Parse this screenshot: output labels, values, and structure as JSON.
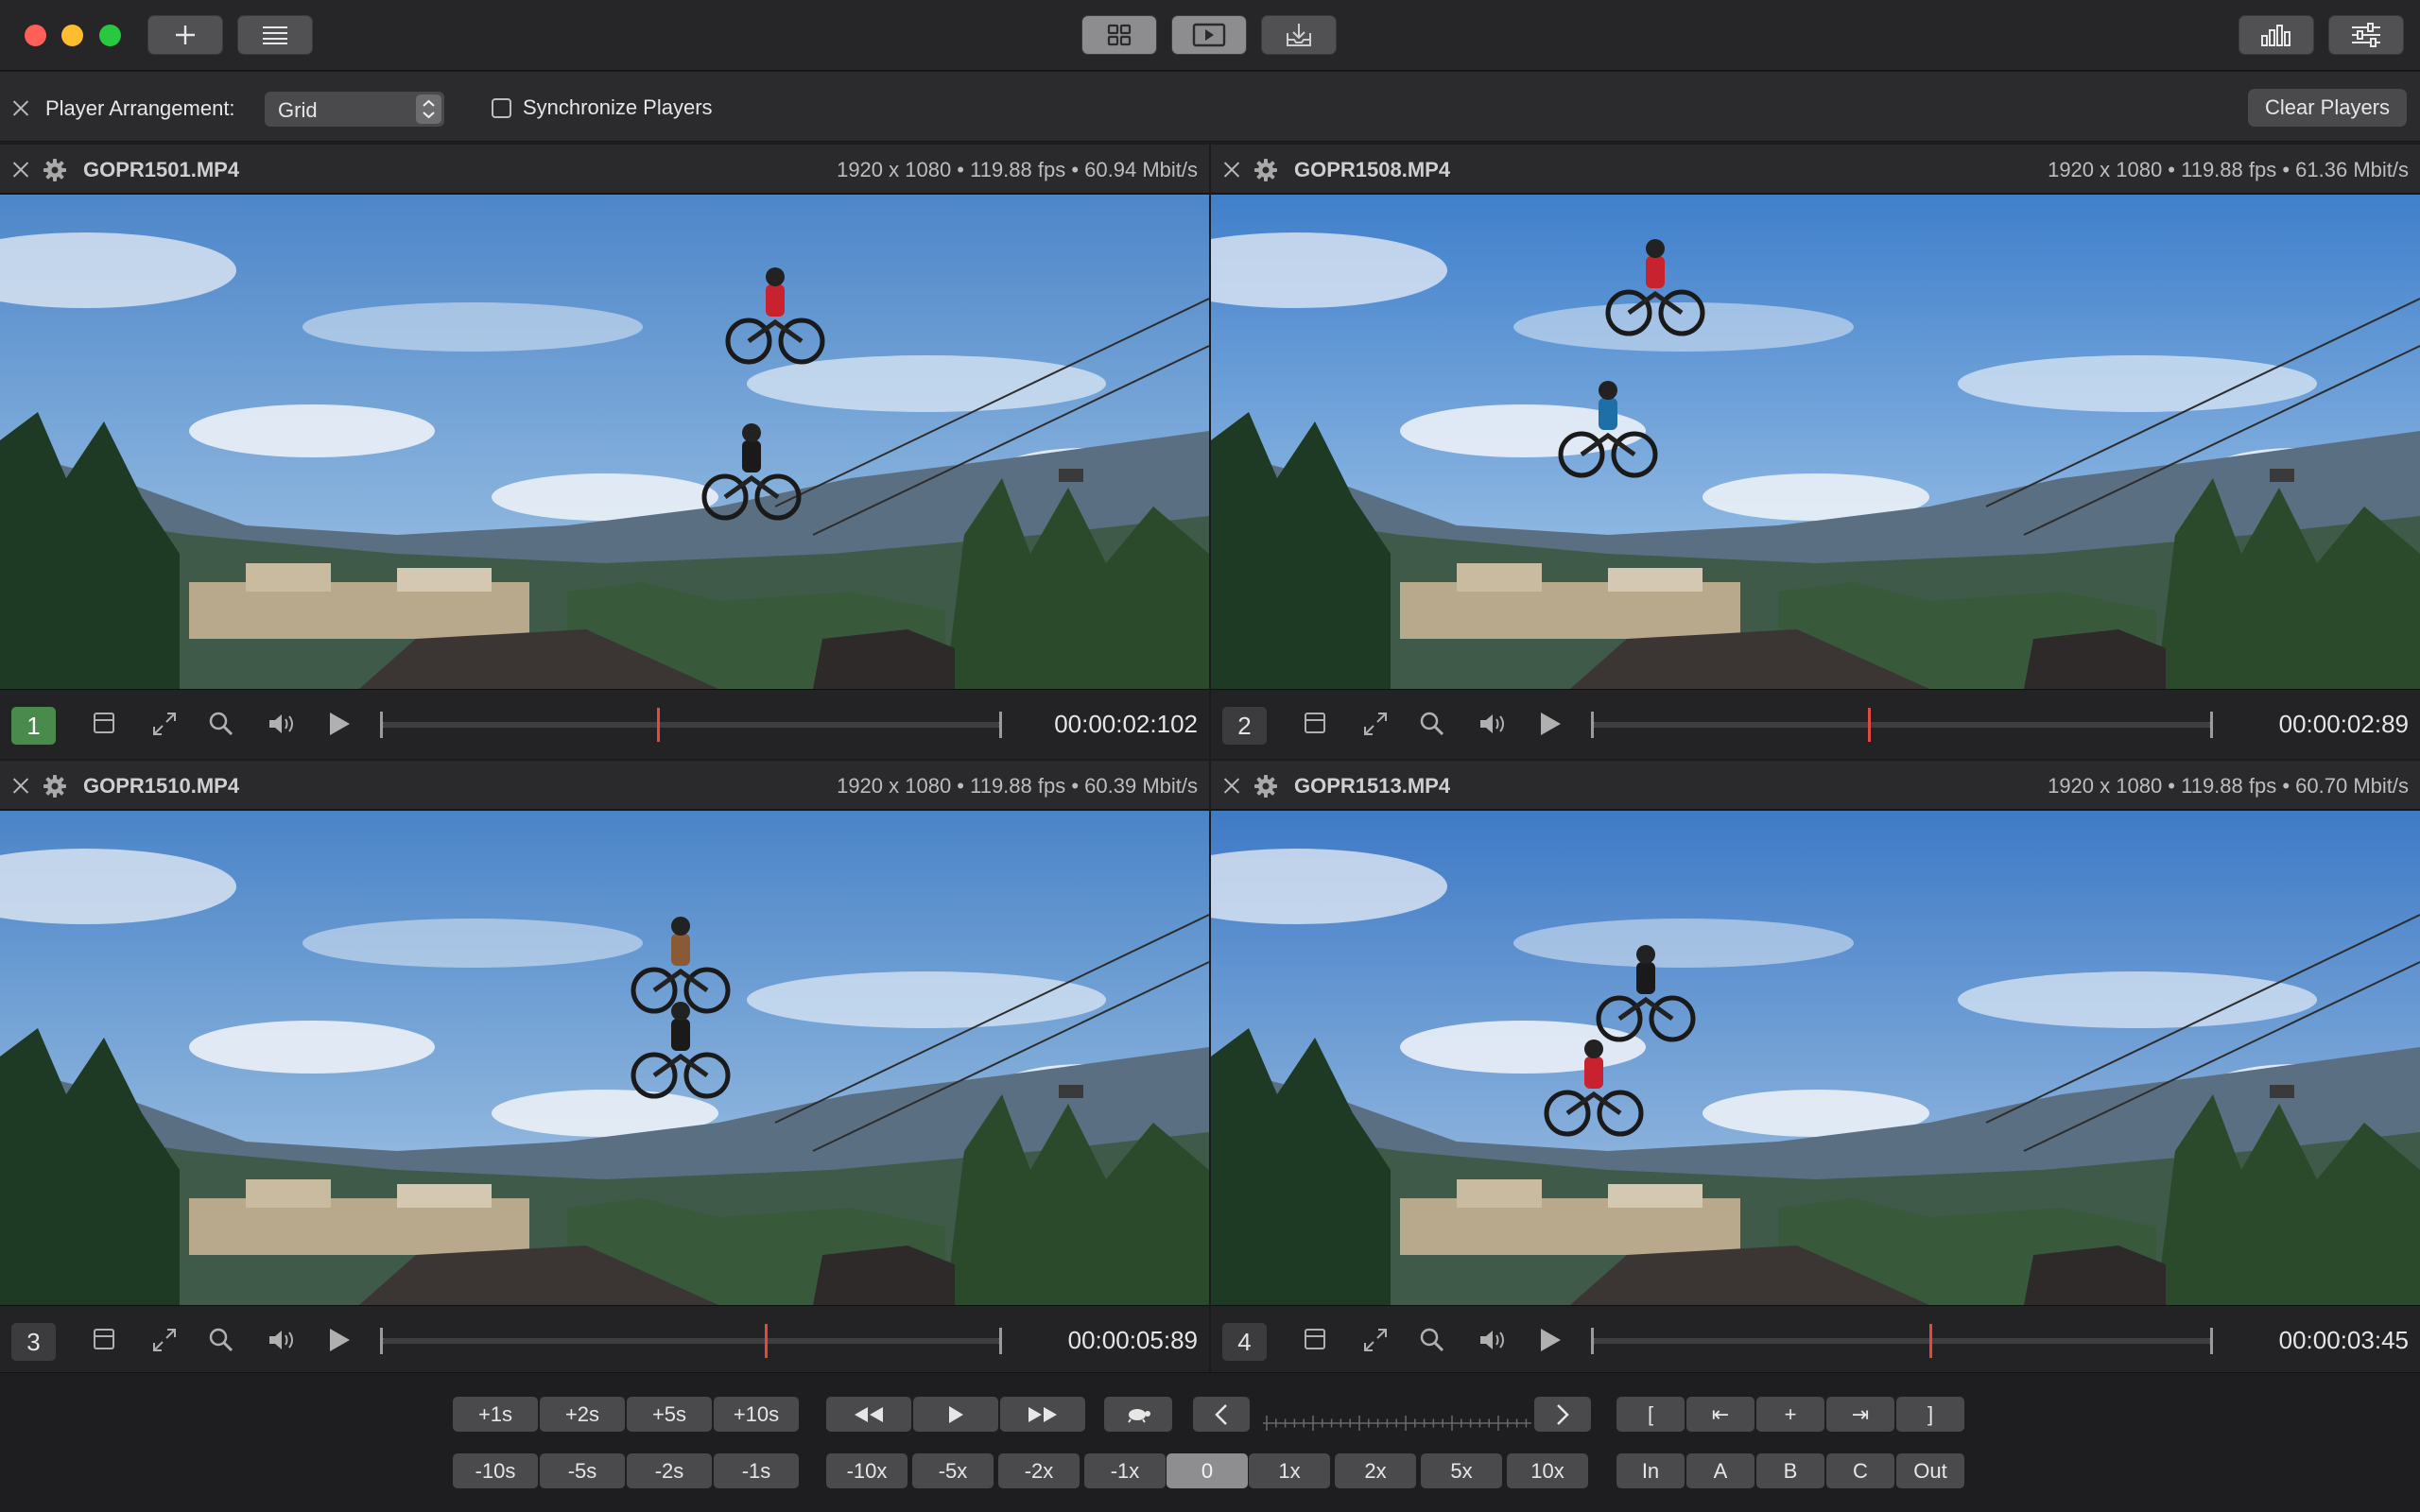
{
  "toolbar": {
    "add_icon": "plus-icon",
    "list_icon": "list-icon",
    "grid_icon": "grid-icon",
    "player_icon": "play-screen-icon",
    "import_icon": "tray-download-icon",
    "chart_icon": "bar-chart-icon",
    "settings_icon": "sliders-icon"
  },
  "arrangement": {
    "label": "Player Arrangement:",
    "selected": "Grid",
    "sync_label": "Synchronize Players",
    "sync_checked": false,
    "clear_label": "Clear Players"
  },
  "players": [
    {
      "number": "1",
      "filename": "GOPR1501.MP4",
      "meta": "1920 x 1080 • 119.88 fps • 60.94 Mbit/s",
      "timecode": "00:00:02:102",
      "progress": 0.445,
      "active": true
    },
    {
      "number": "2",
      "filename": "GOPR1508.MP4",
      "meta": "1920 x 1080 • 119.88 fps • 61.36 Mbit/s",
      "timecode": "00:00:02:89",
      "progress": 0.445,
      "active": false
    },
    {
      "number": "3",
      "filename": "GOPR1510.MP4",
      "meta": "1920 x 1080 • 119.88 fps • 60.39 Mbit/s",
      "timecode": "00:00:05:89",
      "progress": 0.62,
      "active": false
    },
    {
      "number": "4",
      "filename": "GOPR1513.MP4",
      "meta": "1920 x 1080 • 119.88 fps • 60.70 Mbit/s",
      "timecode": "00:00:03:45",
      "progress": 0.545,
      "active": false
    }
  ],
  "transport": {
    "jump_forward": [
      "+1s",
      "+2s",
      "+5s",
      "+10s"
    ],
    "jump_back": [
      "-10s",
      "-5s",
      "-2s",
      "-1s"
    ],
    "speeds": [
      "-10x",
      "-5x",
      "-2x",
      "-1x",
      "0",
      "1x",
      "2x",
      "5x",
      "10x"
    ],
    "speed_selected": "0",
    "marks_top": [
      "[",
      "⇤",
      "+",
      "⇥",
      "]"
    ],
    "marks_bottom": [
      "In",
      "A",
      "B",
      "C",
      "Out"
    ]
  }
}
